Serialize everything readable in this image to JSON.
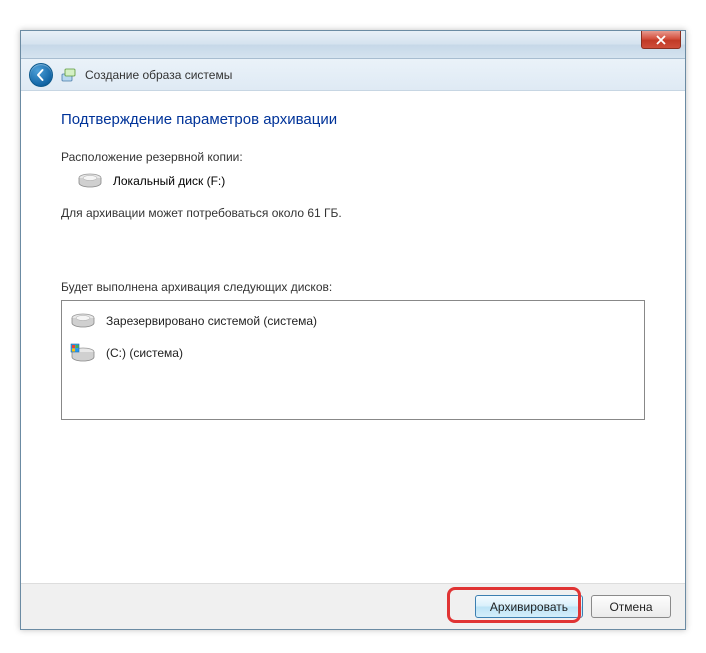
{
  "window": {
    "title": "Создание образа системы"
  },
  "content": {
    "heading": "Подтверждение параметров архивации",
    "location_label": "Расположение резервной копии:",
    "location_value": "Локальный диск (F:)",
    "size_text": "Для архивации может потребоваться около 61 ГБ.",
    "disks_label": "Будет выполнена архивация следующих дисков:",
    "disks": [
      "Зарезервировано системой (система)",
      "(C:) (система)"
    ]
  },
  "buttons": {
    "primary": "Архивировать",
    "cancel": "Отмена"
  }
}
